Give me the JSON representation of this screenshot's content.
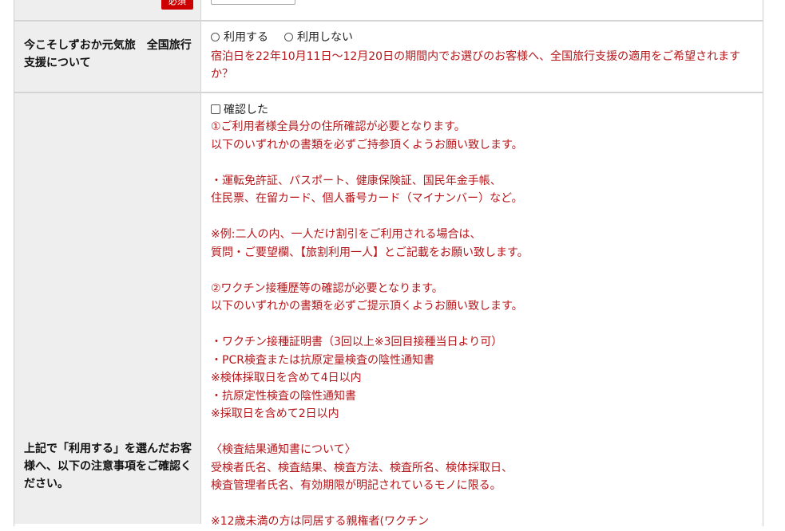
{
  "row_top": {
    "required_badge": "必須",
    "input_value": ""
  },
  "travel_support": {
    "label": "今こそしずおか元気旅　全国旅行支援について",
    "options": [
      "利用する",
      "利用しない"
    ],
    "question": "宿泊日を22年10月11日～12月20日の期間内でお選びのお客様へ、全国旅行支援の適用をご希望されますか？"
  },
  "notice": {
    "label": "上記で「利用する」を選んだお客様へ、以下の注意事項をご確認ください。",
    "checkbox_label": "確認した",
    "lines": [
      "①ご利用者様全員分の住所確認が必要となります。",
      "以下のいずれかの書類を必ずご持参頂くようお願い致します。",
      "",
      "・運転免許証、パスポート、健康保険証、国民年金手帳、",
      "住民票、在留カード、個人番号カード（マイナンバー）など。",
      "",
      "※例:二人の内、一人だけ割引をご利用される場合は、",
      "質問・ご要望欄、【旅割利用一人】とご記載をお願い致します。",
      "",
      "②ワクチン接種歴等の確認が必要となります。",
      "以下のいずれかの書類を必ずご提示頂くようお願い致します。",
      "",
      "・ワクチン接種証明書（3回以上※3回目接種当日より可）",
      "・PCR検査または抗原定量検査の陰性通知書",
      "※検体採取日を含めて4日以内",
      "・抗原定性検査の陰性通知書",
      "※採取日を含めて2日以内",
      "",
      "〈検査結果通知書について〉",
      "受検者氏名、検査結果、検査方法、検査所名、検体採取日、",
      "検査管理者氏名、有効期限が明記されているモノに限る。",
      "",
      "※12歳未満の方は同居する親権者(ワクチン"
    ]
  },
  "colors": {
    "accent_red": "#b5161a",
    "badge_red": "#cc0000",
    "header_bg": "#eeeeee",
    "border": "#d4d4d4"
  }
}
